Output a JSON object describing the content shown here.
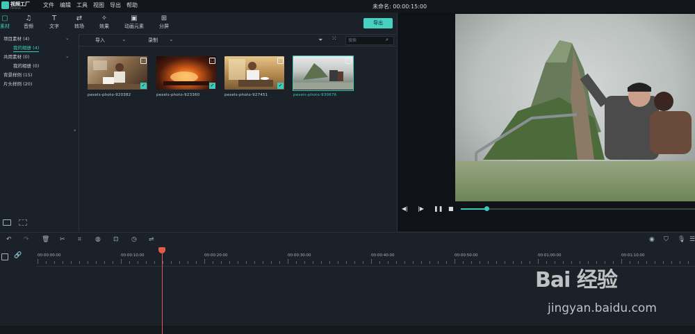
{
  "app": {
    "name": "视频工厂",
    "sub": "Filmora"
  },
  "menu": [
    "文件",
    "编辑",
    "工具",
    "视图",
    "导出",
    "帮助"
  ],
  "project_title": "未命名: 00:00:15:00",
  "tabs": [
    {
      "label": "素材",
      "icon": "folder-icon",
      "glyph": "▢"
    },
    {
      "label": "音频",
      "icon": "music-icon",
      "glyph": "♫"
    },
    {
      "label": "文字",
      "icon": "text-icon",
      "glyph": "T"
    },
    {
      "label": "转场",
      "icon": "transition-icon",
      "glyph": "⇄"
    },
    {
      "label": "效果",
      "icon": "effects-icon",
      "glyph": "✧"
    },
    {
      "label": "动画元素",
      "icon": "elements-icon",
      "glyph": "▣"
    },
    {
      "label": "分屏",
      "icon": "splitscreen-icon",
      "glyph": "⊞"
    }
  ],
  "export_label": "导出",
  "library": {
    "project_media": "项目素材 (4)",
    "my_album": "我的相册 (4)",
    "shared_media": "共用素材 (0)",
    "shared_album": "我的相册 (0)",
    "sample_bg": "背景样例 (15)",
    "sample_intro": "片头样例 (20)"
  },
  "media_toolbar": {
    "import": "导入",
    "record": "录制",
    "search_placeholder": "搜索"
  },
  "media": [
    {
      "name": "pexels-photo-920382",
      "checked": true,
      "selected": false
    },
    {
      "name": "pexels-photo-923360",
      "checked": true,
      "selected": false
    },
    {
      "name": "pexels-photo-927451",
      "checked": true,
      "selected": false
    },
    {
      "name": "pexels-photo-930676",
      "checked": false,
      "selected": true
    }
  ],
  "playback": {
    "progress": 0.11
  },
  "timeline": {
    "timecodes": [
      "00:00:00:00",
      "00:00:10:00",
      "00:00:20:00",
      "00:00:30:00",
      "00:00:40:00",
      "00:00:50:00",
      "00:01:00:00",
      "00:01:10:00"
    ],
    "playhead_time": "00:00:15:00"
  },
  "watermark": {
    "logo": "Bai 经验",
    "url": "jingyan.baidu.com"
  },
  "colors": {
    "accent": "#3ec9b9",
    "playhead": "#e25b4b",
    "panel": "#1b2129"
  }
}
